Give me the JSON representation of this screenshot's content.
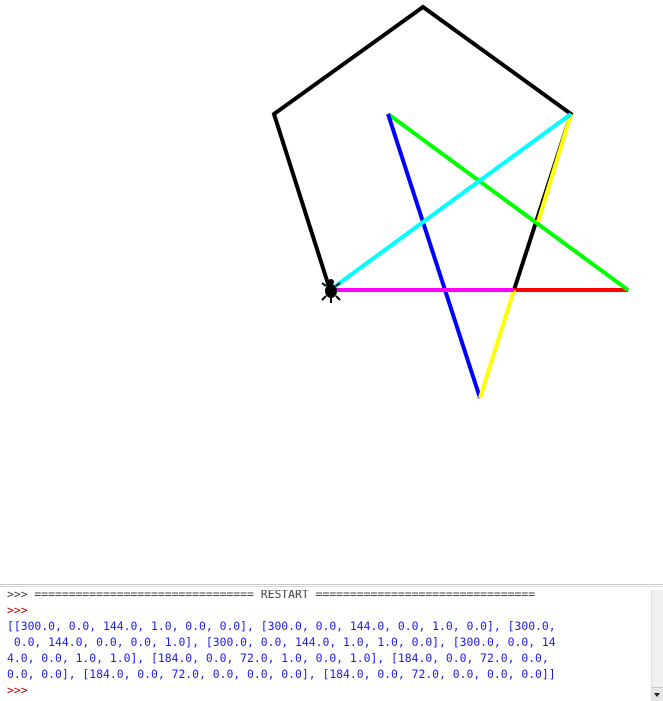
{
  "canvas": {
    "segments": [
      {
        "id": "pentagon",
        "color": "#000000"
      },
      {
        "id": "star-red",
        "color": "#ff0000"
      },
      {
        "id": "star-green",
        "color": "#00ff00"
      },
      {
        "id": "star-blue",
        "color": "#0000ff"
      },
      {
        "id": "star-yellow",
        "color": "#ffff00"
      },
      {
        "id": "star-magenta",
        "color": "#ff00ff"
      },
      {
        "id": "star-cyan",
        "color": "#00ffff"
      }
    ],
    "turtle": {
      "icon": "turtle-icon",
      "color": "#000000"
    }
  },
  "shell": {
    "restart_line": ">>> ================================ RESTART ================================",
    "prompt": ">>>",
    "output_lines": [
      "[[300.0, 0.0, 144.0, 1.0, 0.0, 0.0], [300.0, 0.0, 144.0, 0.0, 1.0, 0.0], [300.0,",
      " 0.0, 144.0, 0.0, 0.0, 1.0], [300.0, 0.0, 144.0, 1.0, 1.0, 0.0], [300.0, 0.0, 14",
      "4.0, 0.0, 1.0, 1.0], [184.0, 0.0, 72.0, 1.0, 0.0, 1.0], [184.0, 0.0, 72.0, 0.0,",
      "0.0, 0.0], [184.0, 0.0, 72.0, 0.0, 0.0, 0.0], [184.0, 0.0, 72.0, 0.0, 0.0, 0.0]]"
    ],
    "end_prompt": ">>>"
  }
}
